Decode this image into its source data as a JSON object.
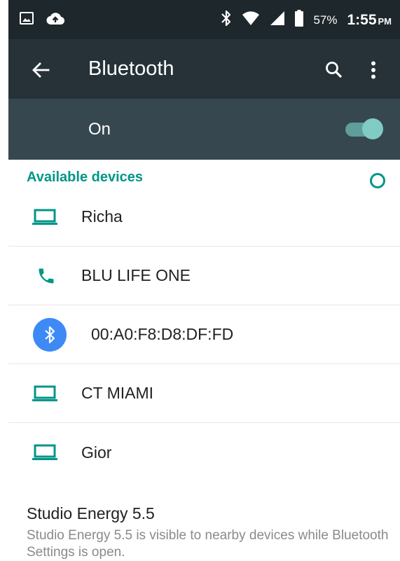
{
  "status_bar": {
    "battery_percent": "57%",
    "time": "1:55",
    "ampm": "PM",
    "icons": [
      "image-icon",
      "cloud-upload-icon",
      "bluetooth-icon",
      "wifi-icon",
      "cellular-signal-icon",
      "battery-icon"
    ]
  },
  "app_bar": {
    "title": "Bluetooth",
    "back_icon": "arrow-back-icon",
    "search_icon": "search-icon",
    "more_icon": "more-vert-icon"
  },
  "switch": {
    "label": "On",
    "state": true
  },
  "available_devices": {
    "header": "Available devices",
    "devices": [
      {
        "name": "Richa",
        "icon": "laptop-icon"
      },
      {
        "name": "BLU LIFE ONE",
        "icon": "phone-icon"
      },
      {
        "name": "00:A0:F8:D8:DF:FD",
        "icon": "bluetooth-device-icon"
      },
      {
        "name": "CT MIAMI",
        "icon": "laptop-icon"
      },
      {
        "name": "Gior",
        "icon": "laptop-icon"
      }
    ]
  },
  "visibility": {
    "title": "Studio Energy 5.5",
    "description": "Studio Energy 5.5 is visible to nearby devices while Bluetooth Settings is open."
  },
  "colors": {
    "accent": "#009688",
    "status_bar": "#1e272b",
    "app_bar": "#263238",
    "switch_bar": "#37474f",
    "bluetooth_circle": "#3d8af7"
  }
}
